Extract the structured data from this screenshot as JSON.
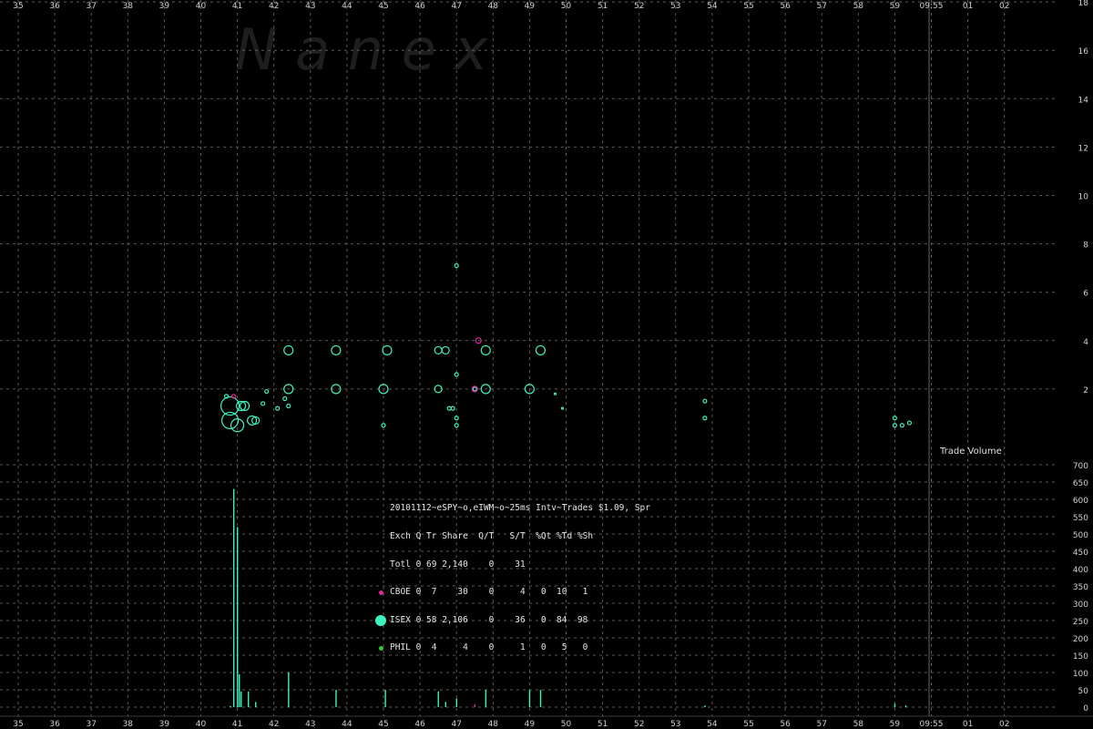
{
  "colors": {
    "background": "#000000",
    "grid": "#5a5a5a",
    "cboe": "#e0279b",
    "isex": "#3cf2c0",
    "phil": "#33cc33",
    "border": "#3a3a3a"
  },
  "watermark": "N  a  n  e  x",
  "info": {
    "title": "20101112~eSPY~o,eIWM~o~25ms Intv~Trades $1.09, Spr",
    "header": "Exch Q Tr Share  Q/T   S/T  %Qt %Td %Sh",
    "rows": [
      {
        "text": "Totl 0 69 2,140    0    31",
        "dot": null
      },
      {
        "text": "CBOE 0  7    30    0     4   0  10   1",
        "dot": "cboe"
      },
      {
        "text": "ISEX 0 58 2,106    0    36   0  84  98",
        "dot": "isex"
      },
      {
        "text": "PHIL 0  4     4    0     1   0   5   0",
        "dot": "phil"
      }
    ]
  },
  "chart_data": [
    {
      "type": "scatter",
      "title": "",
      "xlabel": "",
      "ylabel": "",
      "x_ticks": [
        "35",
        "36",
        "37",
        "38",
        "39",
        "40",
        "41",
        "42",
        "43",
        "44",
        "45",
        "46",
        "47",
        "48",
        "49",
        "50",
        "51",
        "52",
        "53",
        "54",
        "55",
        "56",
        "57",
        "58",
        "59",
        "09:55",
        "01",
        "02"
      ],
      "y_ticks": [
        2,
        4,
        6,
        8,
        10,
        12,
        14,
        16,
        18
      ],
      "ylim": [
        0,
        18
      ],
      "grid": true,
      "series": [
        {
          "name": "ISEX",
          "color": "isex",
          "points": [
            {
              "x": 40.8,
              "y": 1.3,
              "size": 10
            },
            {
              "x": 40.8,
              "y": 0.7,
              "size": 9
            },
            {
              "x": 41.0,
              "y": 0.5,
              "size": 7
            },
            {
              "x": 41.1,
              "y": 1.3,
              "size": 5
            },
            {
              "x": 41.2,
              "y": 1.3,
              "size": 5
            },
            {
              "x": 41.4,
              "y": 0.7,
              "size": 5
            },
            {
              "x": 41.5,
              "y": 0.7,
              "size": 4
            },
            {
              "x": 40.7,
              "y": 1.7,
              "size": 2
            },
            {
              "x": 41.7,
              "y": 1.4,
              "size": 2
            },
            {
              "x": 41.8,
              "y": 1.9,
              "size": 2
            },
            {
              "x": 42.1,
              "y": 1.2,
              "size": 2
            },
            {
              "x": 42.3,
              "y": 1.6,
              "size": 2
            },
            {
              "x": 42.4,
              "y": 1.3,
              "size": 2
            },
            {
              "x": 42.4,
              "y": 2.0,
              "size": 5
            },
            {
              "x": 42.4,
              "y": 3.6,
              "size": 5
            },
            {
              "x": 43.7,
              "y": 2.0,
              "size": 5
            },
            {
              "x": 43.7,
              "y": 3.6,
              "size": 5
            },
            {
              "x": 45.0,
              "y": 2.0,
              "size": 5
            },
            {
              "x": 45.1,
              "y": 3.6,
              "size": 5
            },
            {
              "x": 45.0,
              "y": 0.5,
              "size": 2
            },
            {
              "x": 46.5,
              "y": 2.0,
              "size": 4
            },
            {
              "x": 46.5,
              "y": 3.6,
              "size": 4
            },
            {
              "x": 46.7,
              "y": 3.6,
              "size": 4
            },
            {
              "x": 46.8,
              "y": 1.2,
              "size": 2
            },
            {
              "x": 46.9,
              "y": 1.2,
              "size": 2
            },
            {
              "x": 47.0,
              "y": 2.6,
              "size": 2
            },
            {
              "x": 47.0,
              "y": 0.8,
              "size": 2
            },
            {
              "x": 47.0,
              "y": 0.5,
              "size": 2
            },
            {
              "x": 47.0,
              "y": 7.1,
              "size": 2
            },
            {
              "x": 47.5,
              "y": 2.0,
              "size": 2
            },
            {
              "x": 47.8,
              "y": 2.0,
              "size": 5
            },
            {
              "x": 47.8,
              "y": 3.6,
              "size": 5
            },
            {
              "x": 49.0,
              "y": 2.0,
              "size": 5
            },
            {
              "x": 49.3,
              "y": 3.6,
              "size": 5
            },
            {
              "x": 49.7,
              "y": 1.8,
              "size": 1
            },
            {
              "x": 49.9,
              "y": 1.2,
              "size": 1
            },
            {
              "x": 53.8,
              "y": 1.5,
              "size": 2
            },
            {
              "x": 53.8,
              "y": 0.8,
              "size": 2
            },
            {
              "x": 59.0,
              "y": 0.8,
              "size": 2
            },
            {
              "x": 59.0,
              "y": 0.5,
              "size": 2
            },
            {
              "x": 59.2,
              "y": 0.5,
              "size": 2
            },
            {
              "x": 59.4,
              "y": 0.6,
              "size": 2
            }
          ]
        },
        {
          "name": "CBOE",
          "color": "cboe",
          "points": [
            {
              "x": 40.9,
              "y": 1.7,
              "size": 2
            },
            {
              "x": 47.5,
              "y": 2.0,
              "size": 3
            },
            {
              "x": 47.6,
              "y": 4.0,
              "size": 3
            }
          ]
        }
      ]
    },
    {
      "type": "bar",
      "title": "Trade Volume",
      "y_ticks": [
        0,
        50,
        100,
        150,
        200,
        250,
        300,
        350,
        400,
        450,
        500,
        550,
        600,
        650,
        700
      ],
      "ylim": [
        0,
        700
      ],
      "grid": true,
      "bars": [
        {
          "x": 40.8,
          "value": 3,
          "color": "isex"
        },
        {
          "x": 40.9,
          "value": 630,
          "color": "isex"
        },
        {
          "x": 41.0,
          "value": 520,
          "color": "isex"
        },
        {
          "x": 41.05,
          "value": 95,
          "color": "isex"
        },
        {
          "x": 41.1,
          "value": 45,
          "color": "isex"
        },
        {
          "x": 41.3,
          "value": 45,
          "color": "isex"
        },
        {
          "x": 41.5,
          "value": 15,
          "color": "isex"
        },
        {
          "x": 42.4,
          "value": 100,
          "color": "isex"
        },
        {
          "x": 43.7,
          "value": 50,
          "color": "isex"
        },
        {
          "x": 45.05,
          "value": 50,
          "color": "isex"
        },
        {
          "x": 46.5,
          "value": 45,
          "color": "isex"
        },
        {
          "x": 46.7,
          "value": 15,
          "color": "isex"
        },
        {
          "x": 47.0,
          "value": 25,
          "color": "isex"
        },
        {
          "x": 47.5,
          "value": 8,
          "color": "cboe"
        },
        {
          "x": 47.8,
          "value": 50,
          "color": "isex"
        },
        {
          "x": 49.0,
          "value": 50,
          "color": "isex"
        },
        {
          "x": 49.3,
          "value": 50,
          "color": "isex"
        },
        {
          "x": 53.8,
          "value": 5,
          "color": "isex"
        },
        {
          "x": 59.0,
          "value": 10,
          "color": "isex"
        },
        {
          "x": 59.3,
          "value": 5,
          "color": "isex"
        }
      ]
    }
  ]
}
